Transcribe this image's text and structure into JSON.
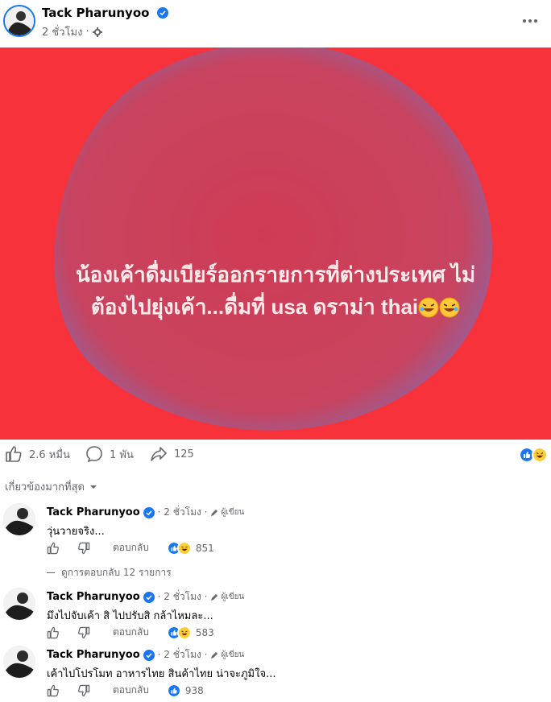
{
  "post": {
    "author": "Tack Pharunyoo",
    "time": "2 ชั่วโมง",
    "privacy_icon": "friends-gear-icon",
    "image_text_line1": "น้องเค้าดื่มเบียร์ออกรายการที่ต่างประเทศ ไม่",
    "image_text_line2": "ต้องไปยุ่งเค้า...ดื่มที่ usa ดราม่า thai",
    "image_emoji": "🤣🤣",
    "colors": {
      "background": "#f8323a",
      "blob": "#c9405f",
      "text": "#ffeaea",
      "accent": "#1877f2"
    }
  },
  "actions": {
    "likes": "2.6 หมื่น",
    "comments": "1 พัน",
    "shares": "125"
  },
  "sort_label": "เกี่ยวข้องมากที่สุด",
  "comments": [
    {
      "name": "Tack Pharunyoo",
      "time": "· 2 ชั่วโมง ·",
      "author_badge": "ผู้เขียน",
      "text": "วุ่นวายจริง...",
      "reply": "ตอบกลับ",
      "reactions": "851"
    },
    {
      "name": "Tack Pharunyoo",
      "time": "· 2 ชั่วโมง ·",
      "author_badge": "ผู้เขียน",
      "text": "มึงไปจับเค้า สิ ไปปรับสิ กล้าไหมละ...",
      "reply": "ตอบกลับ",
      "reactions": "583"
    },
    {
      "name": "Tack Pharunyoo",
      "time": "· 2 ชั่วโมง ·",
      "author_badge": "ผู้เขียน",
      "text": "เค้าไปโปรโมท อาหารไทย สินค้าไทย น่าจะภูมิใจ...",
      "reply": "ตอบกลับ",
      "reactions": "938"
    }
  ],
  "view_replies": "ดูการตอบกลับ 12 รายการ"
}
